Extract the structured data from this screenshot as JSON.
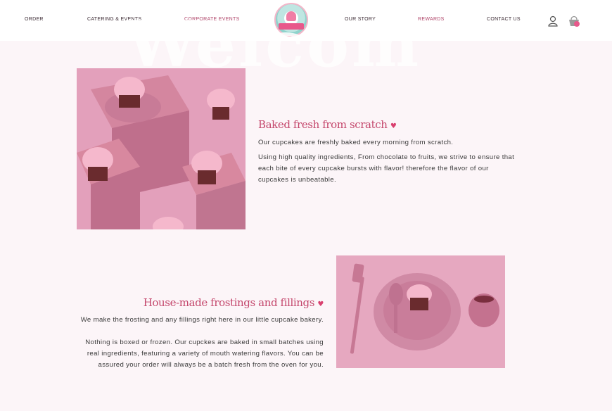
{
  "nav": {
    "order": "ORDER",
    "catering": "CATERING & EVENTS",
    "corporate": "CORPORATE EVENTS",
    "story": "OUR STORY",
    "rewards": "REWARDS",
    "contact": "CONTACT US"
  },
  "cart": {
    "count": "0"
  },
  "watermark": "Welcom",
  "section1": {
    "title": "Baked fresh from scratch",
    "line1": "Our cupcakes are freshly baked every morning from scratch.",
    "line2": "Using high quality ingredients, From chocolate to fruits, we strive to ensure that each bite of every cupcake bursts with flavor! therefore the flavor of our cupcakes is unbeatable."
  },
  "section2": {
    "title": "House-made frostings and fillings",
    "line1": "We make the frosting and any fillings right here in our little cupcake bakery.",
    "line2": "Nothing is boxed or frozen. Our cupckes are baked in small batches using real ingredients, featuring a variety of mouth watering flavors. You can be assured your order will always be a batch fresh from the oven for you."
  },
  "colors": {
    "accent": "#c4476c",
    "nav_pink": "#b0466a",
    "background": "#fcf5f8"
  },
  "icons": [
    "user-icon",
    "shopping-basket-icon",
    "heart-icon"
  ]
}
